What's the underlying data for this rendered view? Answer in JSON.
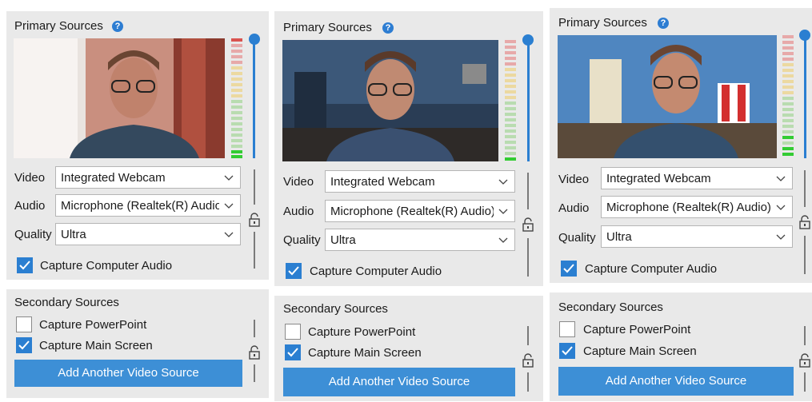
{
  "primary": {
    "title": "Primary Sources",
    "help_icon": "?",
    "video_label": "Video",
    "video_value": "Integrated Webcam",
    "audio_label": "Audio",
    "audio_value": "Microphone (Realtek(R) Audio)",
    "quality_label": "Quality",
    "quality_value": "Ultra",
    "capture_audio_label": "Capture Computer Audio",
    "capture_audio_checked": true
  },
  "secondary": {
    "title": "Secondary Sources",
    "powerpoint_label": "Capture PowerPoint",
    "powerpoint_checked": false,
    "main_screen_label": "Capture Main Screen",
    "main_screen_checked": true,
    "add_button_label": "Add Another Video Source"
  },
  "colors": {
    "accent": "#2b7fd1",
    "panel": "#e9e9e9"
  },
  "icons": [
    "help-icon",
    "chevron-down-icon",
    "check-icon",
    "lock-icon",
    "webcam-preview"
  ]
}
